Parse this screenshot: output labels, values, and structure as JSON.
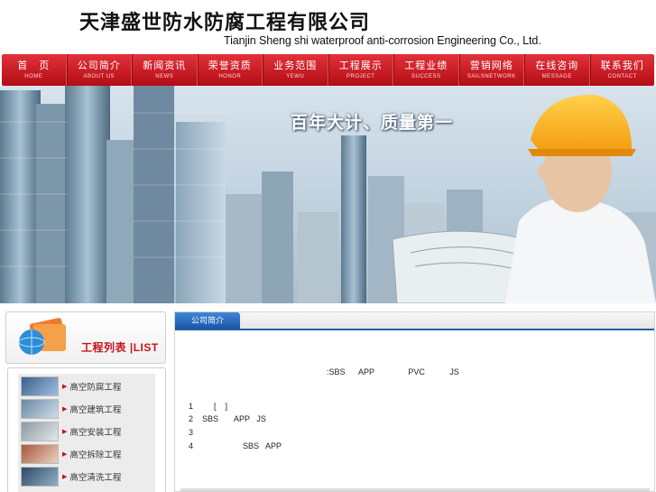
{
  "header": {
    "company_cn": "天津盛世防水防腐工程有限公司",
    "company_en": "Tianjin Sheng shi waterproof anti-corrosion Engineering Co., Ltd."
  },
  "nav": [
    {
      "cn": "首　页",
      "en": "HOME"
    },
    {
      "cn": "公司简介",
      "en": "ABOUT US"
    },
    {
      "cn": "新闻资讯",
      "en": "NEWS"
    },
    {
      "cn": "荣誉资质",
      "en": "HONOR"
    },
    {
      "cn": "业务范围",
      "en": "YEWU"
    },
    {
      "cn": "工程展示",
      "en": "PROJECT"
    },
    {
      "cn": "工程业绩",
      "en": "SUCCESS"
    },
    {
      "cn": "营销网络",
      "en": "SAILSNETWORK"
    },
    {
      "cn": "在线咨询",
      "en": "MESSAGE"
    },
    {
      "cn": "联系我们",
      "en": "CONTACT"
    }
  ],
  "banner": {
    "slogan": "百年大计、质量第一"
  },
  "sidebar": {
    "title": "工程列表 |LIST",
    "items": [
      {
        "label": "高空防腐工程"
      },
      {
        "label": "高空建筑工程"
      },
      {
        "label": "高空安装工程"
      },
      {
        "label": "高空拆除工程"
      },
      {
        "label": "高空清洗工程"
      }
    ]
  },
  "main": {
    "tab": "公司简介",
    "line1": ":SBS      APP               PVC           JS",
    "rows": [
      {
        "num": "1",
        "text": "      [    ]"
      },
      {
        "num": "2",
        "text": "SBS       APP   JS"
      },
      {
        "num": "3",
        "text": ""
      },
      {
        "num": "4",
        "text": "                  SBS   APP"
      }
    ]
  },
  "colors": {
    "nav_red": "#c4131a",
    "tab_blue": "#1f5fae"
  }
}
